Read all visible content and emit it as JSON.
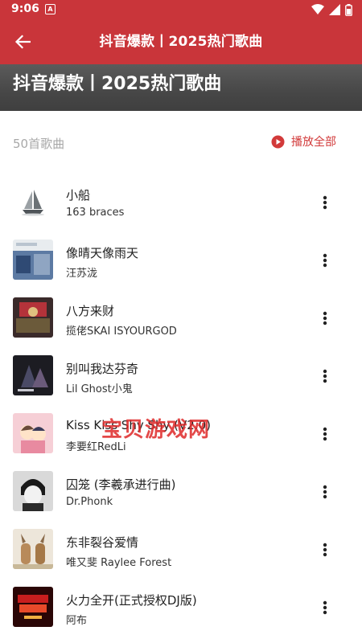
{
  "status_bar": {
    "time": "9:06",
    "notification_icon": "A"
  },
  "app_bar": {
    "title": "抖音爆款丨2025热门歌曲",
    "back_icon": "arrow-left"
  },
  "hero": {
    "title": "抖音爆款丨2025热门歌曲"
  },
  "list_header": {
    "count_label": "50首歌曲",
    "play_all_label": "播放全部",
    "play_all_icon": "play-circle"
  },
  "songs": [
    {
      "title": "小船",
      "artist": "163 braces"
    },
    {
      "title": "像晴天像雨天",
      "artist": "汪苏泷"
    },
    {
      "title": "八方来财",
      "artist": "揽佬SKAI ISYOURGOD"
    },
    {
      "title": "别叫我达芬奇",
      "artist": "Lil Ghost小鬼"
    },
    {
      "title": "Kiss Kiss Shy Shy (V2.0)",
      "artist": "李要红RedLi"
    },
    {
      "title": "囚笼 (李羲承进行曲)",
      "artist": "Dr.Phonk"
    },
    {
      "title": "东非裂谷爱情",
      "artist": "唯又斐 Raylee Forest"
    },
    {
      "title": "火力全开(正式授权DJ版)",
      "artist": "阿布"
    }
  ],
  "watermark": "宝贝游戏网",
  "colors": {
    "app_bar": "#c9353a",
    "accent": "#d23a3a",
    "hero": "#474747"
  }
}
